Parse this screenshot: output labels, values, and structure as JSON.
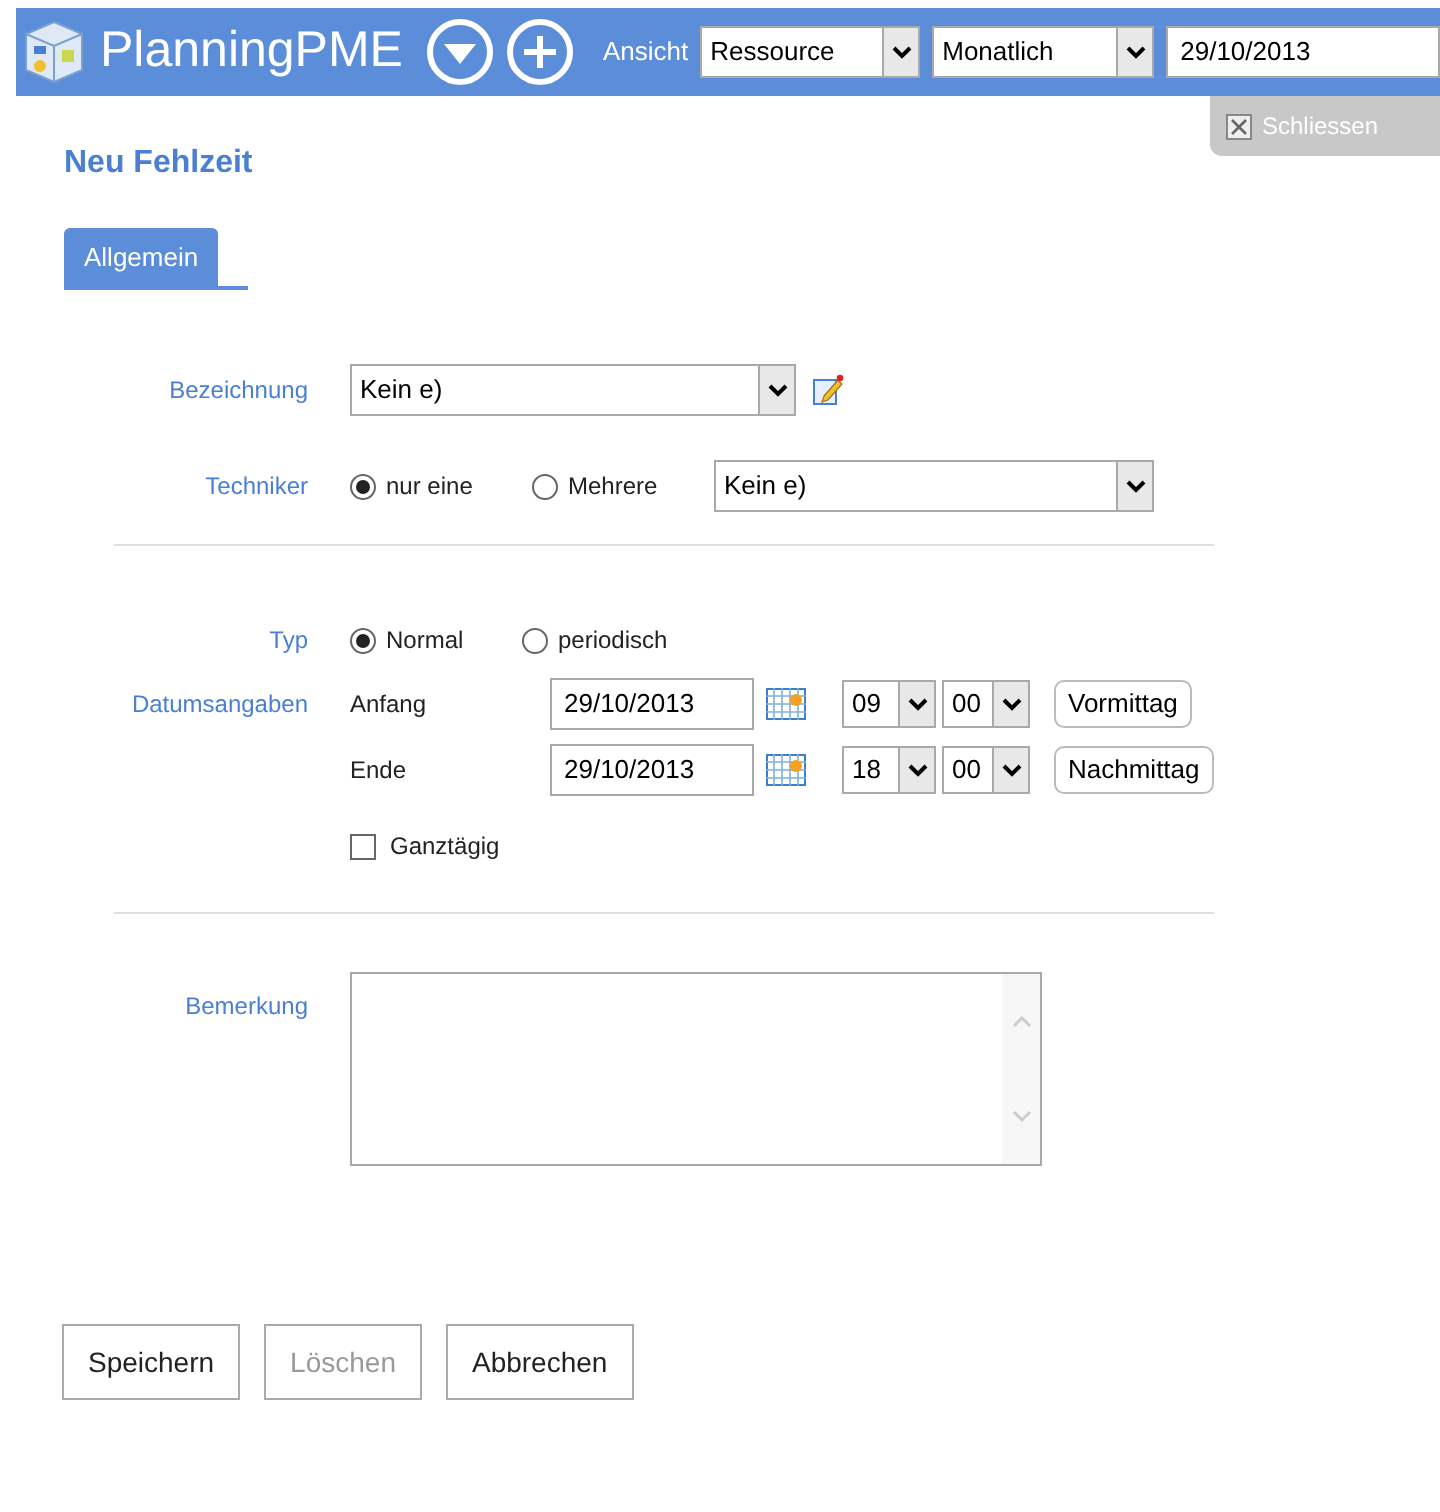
{
  "header": {
    "app_name": "PlanningPME",
    "view_label": "Ansicht",
    "view_select": "Ressource",
    "period_select": "Monatlich",
    "date": "29/10/2013"
  },
  "close_button": "Schliessen",
  "title": "Neu Fehlzeit",
  "tabs": [
    {
      "label": "Allgemein",
      "selected": true
    }
  ],
  "bezeichnung": {
    "label": "Bezeichnung",
    "value": "Kein e)"
  },
  "techniker": {
    "label": "Techniker",
    "options": [
      {
        "label": "nur eine",
        "selected": true
      },
      {
        "label": "Mehrere",
        "selected": false
      }
    ],
    "value": "Kein e)"
  },
  "typ": {
    "label": "Typ",
    "options": [
      {
        "label": "Normal",
        "selected": true
      },
      {
        "label": "periodisch",
        "selected": false
      }
    ]
  },
  "dates": {
    "label": "Datumsangaben",
    "rows": [
      {
        "label": "Anfang",
        "date": "29/10/2013",
        "hour": "09",
        "minute": "00",
        "button": "Vormittag"
      },
      {
        "label": "Ende",
        "date": "29/10/2013",
        "hour": "18",
        "minute": "00",
        "button": "Nachmittag"
      }
    ]
  },
  "all_day": {
    "label": "Ganztägig",
    "checked": false
  },
  "remark": {
    "label": "Bemerkung"
  },
  "buttons": [
    {
      "label": "Speichern",
      "disabled": false
    },
    {
      "label": "Löschen",
      "disabled": true
    },
    {
      "label": "Abbrechen",
      "disabled": false
    }
  ]
}
